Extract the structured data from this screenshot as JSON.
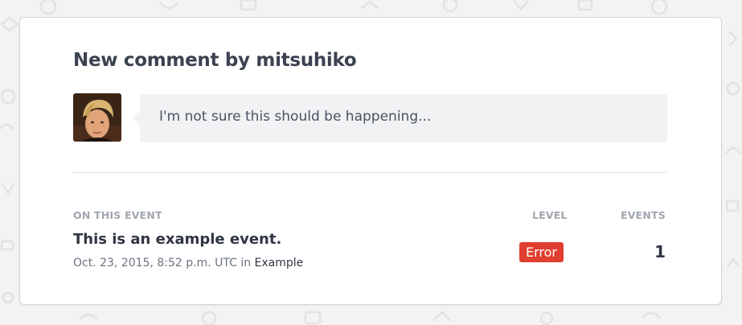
{
  "notification": {
    "title": "New comment by mitsuhiko",
    "comment_text": "I'm not sure this should be happening...",
    "avatar_icon": "user-avatar-photo"
  },
  "table": {
    "header_event": "ON THIS EVENT",
    "header_level": "LEVEL",
    "header_events": "EVENTS"
  },
  "event": {
    "title": "This is an example event.",
    "timestamp": "Oct. 23, 2015, 8:52 p.m. UTC",
    "in_label": "in",
    "project": "Example",
    "level": "Error",
    "count": "1"
  },
  "colors": {
    "background": "#f3f3f3",
    "card": "#ffffff",
    "bubble": "#f1f2f4",
    "level_error": "#e03e2f",
    "heading_text": "#3a4250",
    "muted_text": "#a1a7b0"
  }
}
